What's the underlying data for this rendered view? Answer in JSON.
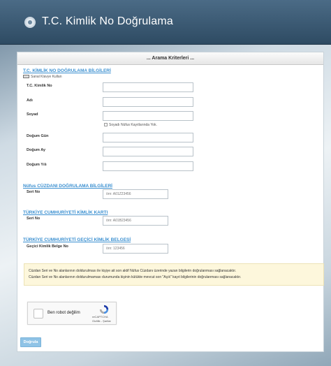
{
  "header": {
    "title": "T.C. Kimlik No Doğrulama"
  },
  "panel": {
    "title": "... Arama Kriterleri ..."
  },
  "kimlik": {
    "section_title": "T.C. KİMLİK NO DOĞRULAMA BİLGİLERİ",
    "keyboard_label": "Sanal Klavye Kullan",
    "tc_label": "T.C. Kimlik No",
    "ad_label": "Adı",
    "soyad_label": "Soyad",
    "soyad_check_label": "Soyadı Nüfus Kayıtlarında Yok.",
    "gun_label": "Doğum Gün",
    "ay_label": "Doğum Ay",
    "yil_label": "Doğum Yılı"
  },
  "cuzdan": {
    "section_title": "Nüfus CÜZDANI DOĞRULAMA BİLGİLERİ",
    "seri_label": "Seri No",
    "seri_placeholder": "örn: A01Z23456"
  },
  "kart": {
    "section_title": "TÜRKİYE CUMHURİYETİ KİMLİK KARTI",
    "seri_label": "Seri No",
    "seri_placeholder": "örn: A01B23456"
  },
  "gecici": {
    "section_title": "TÜRKİYE CUMHURİYETİ GEÇİCİ KİMLİK BELGESİ",
    "belge_label": "Geçici Kimlik Belge No",
    "belge_placeholder": "örn: 123456"
  },
  "notice": {
    "line1": "Cüzdan Seri ve No alanlarının doldurulması ile kişiye ait son aktif Nüfus Cüzdanı üzerinde yazan bilgilerin doğrulanması sağlanacaktır.",
    "line2": "Cüzdan Seri ve No alanlarının doldurulmaması durumunda kişinin kütükte mevcut son \"Açık\" kayıt bilgilerinin doğrulanması sağlanacaktır."
  },
  "captcha": {
    "label": "Ben robot değilim",
    "brand": "reCAPTCHA",
    "links": "Gizlilik - Şartlar"
  },
  "submit_label": "Doğrula"
}
